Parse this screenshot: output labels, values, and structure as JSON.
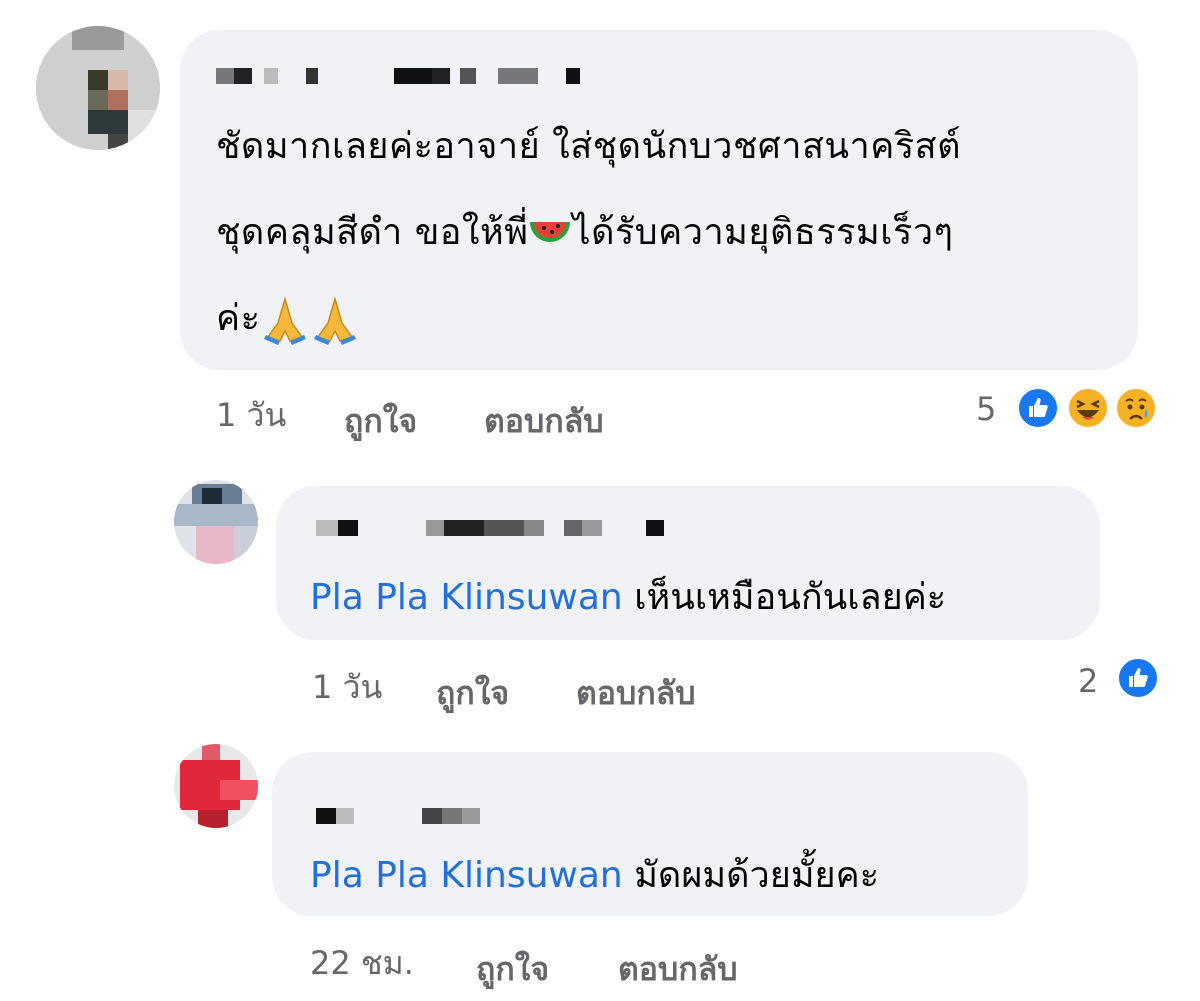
{
  "comments": [
    {
      "text_line1": "ชัดมากเลยค่ะอาจาย์ ใส่ชุดนักบวชศาสนาคริสต์",
      "text_line2_a": "ชุดคลุมสีดำ ขอให้พี่",
      "text_line2_b": "ได้รับความยุติธรรมเร็วๆ",
      "text_line3": "ค่ะ",
      "time": "1 วัน",
      "like_label": "ถูกใจ",
      "reply_label": "ตอบกลับ",
      "reaction_count": "5",
      "reactions": [
        "like-icon",
        "haha-icon",
        "sad-icon"
      ]
    }
  ],
  "replies": [
    {
      "mention": "Pla Pla Klinsuwan",
      "text": "เห็นเหมือนกันเลยค่ะ",
      "time": "1 วัน",
      "like_label": "ถูกใจ",
      "reply_label": "ตอบกลับ",
      "reaction_count": "2",
      "reactions": [
        "like-icon"
      ]
    },
    {
      "mention": "Pla Pla Klinsuwan",
      "text": "มัดผมด้วยมั้ยคะ",
      "time": "22 ชม.",
      "like_label": "ถูกใจ",
      "reply_label": "ตอบกลับ"
    }
  ],
  "colors": {
    "bubble": "#f0f2f5",
    "mention": "#216fdb",
    "meta": "#65676b",
    "like": "#1877f2"
  }
}
